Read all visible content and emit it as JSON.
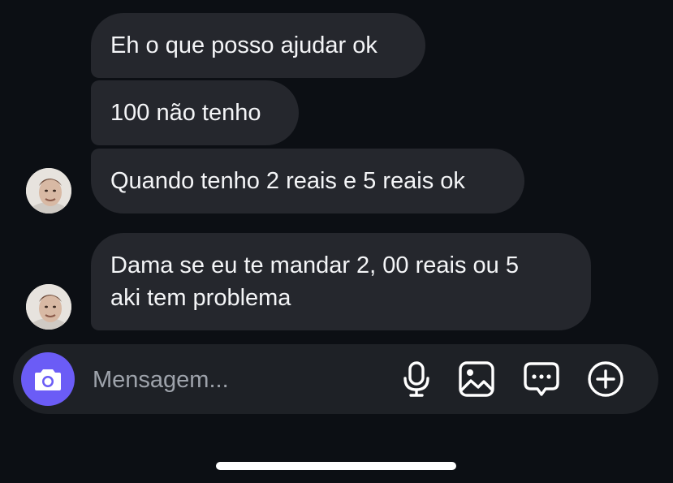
{
  "messages": [
    {
      "text": "Eh o que posso ajudar ok"
    },
    {
      "text": "100 não tenho"
    },
    {
      "text": "Quando tenho 2 reais e 5 reais ok"
    },
    {
      "text": "Dama se eu te mandar 2, 00 reais ou 5\naki tem problema"
    }
  ],
  "composer": {
    "placeholder": "Mensagem..."
  },
  "icons": {
    "camera": "camera-icon",
    "mic": "microphone-icon",
    "gallery": "image-gallery-icon",
    "sticker": "chat-bubble-icon",
    "more": "plus-circle-icon",
    "avatar": "user-avatar"
  },
  "colors": {
    "background": "#0c0f14",
    "bubble": "#25272d",
    "composer": "#1e2126",
    "camera_button": "#6b5cf6",
    "placeholder": "#9ea3ab"
  }
}
